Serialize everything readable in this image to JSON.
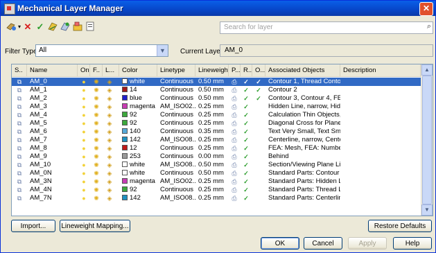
{
  "window": {
    "title": "Mechanical Layer Manager",
    "close_symbol": "✕"
  },
  "search": {
    "placeholder": "Search for layer"
  },
  "filter": {
    "label": "Filter Type:",
    "value": "All"
  },
  "current_layer": {
    "label": "Current Layer:",
    "value": "AM_0"
  },
  "columns": [
    "S..",
    "Name",
    "On",
    "F..",
    "L...",
    "Color",
    "Linetype",
    "Lineweight",
    "P...",
    "R...",
    "O...",
    "Associated Objects",
    "Description"
  ],
  "rows": [
    {
      "name": "AM_0",
      "color_name": "white",
      "color_hex": "#ffffff",
      "linetype": "Continuous",
      "lineweight": "0.50 mm",
      "o": true,
      "assoc": "Contour 1, Thread Contou..."
    },
    {
      "name": "AM_1",
      "color_name": "14",
      "color_hex": "#a31919",
      "linetype": "Continuous",
      "lineweight": "0.50 mm",
      "o": true,
      "assoc": "Contour 2"
    },
    {
      "name": "AM_2",
      "color_name": "blue",
      "color_hex": "#1e1ecc",
      "linetype": "Continuous",
      "lineweight": "0.50 mm",
      "o": true,
      "assoc": "Contour 3, Contour 4, FE..."
    },
    {
      "name": "AM_3",
      "color_name": "magenta",
      "color_hex": "#c83cb4",
      "linetype": "AM_ISO02...",
      "lineweight": "0.25 mm",
      "o": false,
      "assoc": "Hidden Line, narrow, Hidd..."
    },
    {
      "name": "AM_4",
      "color_name": "92",
      "color_hex": "#3ca83c",
      "linetype": "Continuous",
      "lineweight": "0.25 mm",
      "o": false,
      "assoc": "Calculation Thin Objects, ..."
    },
    {
      "name": "AM_5",
      "color_name": "92",
      "color_hex": "#3ca83c",
      "linetype": "Continuous",
      "lineweight": "0.25 mm",
      "o": false,
      "assoc": "Diagonal Cross for Planes,..."
    },
    {
      "name": "AM_6",
      "color_name": "140",
      "color_hex": "#56a8d8",
      "linetype": "Continuous",
      "lineweight": "0.35 mm",
      "o": false,
      "assoc": "Text Very Small, Text Smal..."
    },
    {
      "name": "AM_7",
      "color_name": "142",
      "color_hex": "#1e90c0",
      "linetype": "AM_ISO08...",
      "lineweight": "0.25 mm",
      "o": false,
      "assoc": "Centerline, narrow, Cente..."
    },
    {
      "name": "AM_8",
      "color_name": "12",
      "color_hex": "#c01818",
      "linetype": "Continuous",
      "lineweight": "0.25 mm",
      "o": false,
      "assoc": "FEA: Mesh, FEA: Numbers..."
    },
    {
      "name": "AM_9",
      "color_name": "253",
      "color_hex": "#9a9a9a",
      "linetype": "Continuous",
      "lineweight": "0.00 mm",
      "o": false,
      "assoc": "Behind"
    },
    {
      "name": "AM_10",
      "color_name": "white",
      "color_hex": "#ffffff",
      "linetype": "AM_ISO08...",
      "lineweight": "0.50 mm",
      "o": false,
      "assoc": "Section/Viewing Plane Line"
    },
    {
      "name": "AM_0N",
      "color_name": "white",
      "color_hex": "#ffffff",
      "linetype": "Continuous",
      "lineweight": "0.50 mm",
      "o": false,
      "assoc": "Standard Parts: Contour 1..."
    },
    {
      "name": "AM_3N",
      "color_name": "magenta",
      "color_hex": "#c83cb4",
      "linetype": "AM_ISO02...",
      "lineweight": "0.25 mm",
      "o": false,
      "assoc": "Standard Parts: Hidden Lin..."
    },
    {
      "name": "AM_4N",
      "color_name": "92",
      "color_hex": "#3ca83c",
      "linetype": "Continuous",
      "lineweight": "0.25 mm",
      "o": false,
      "assoc": "Standard Parts: Thread Line"
    },
    {
      "name": "AM_7N",
      "color_name": "142",
      "color_hex": "#1e90c0",
      "linetype": "AM_ISO08...",
      "lineweight": "0.25 mm",
      "o": false,
      "assoc": "Standard Parts: Centerline..."
    }
  ],
  "buttons": {
    "import": "Import...",
    "lineweight_mapping": "Lineweight Mapping...",
    "restore_defaults": "Restore Defaults",
    "ok": "OK",
    "cancel": "Cancel",
    "apply": "Apply",
    "help": "Help"
  },
  "colors": {
    "selection": "#316ac5",
    "check": "#2e9e2e",
    "delete": "#d81e1e",
    "bulb": "#f2d23a"
  }
}
